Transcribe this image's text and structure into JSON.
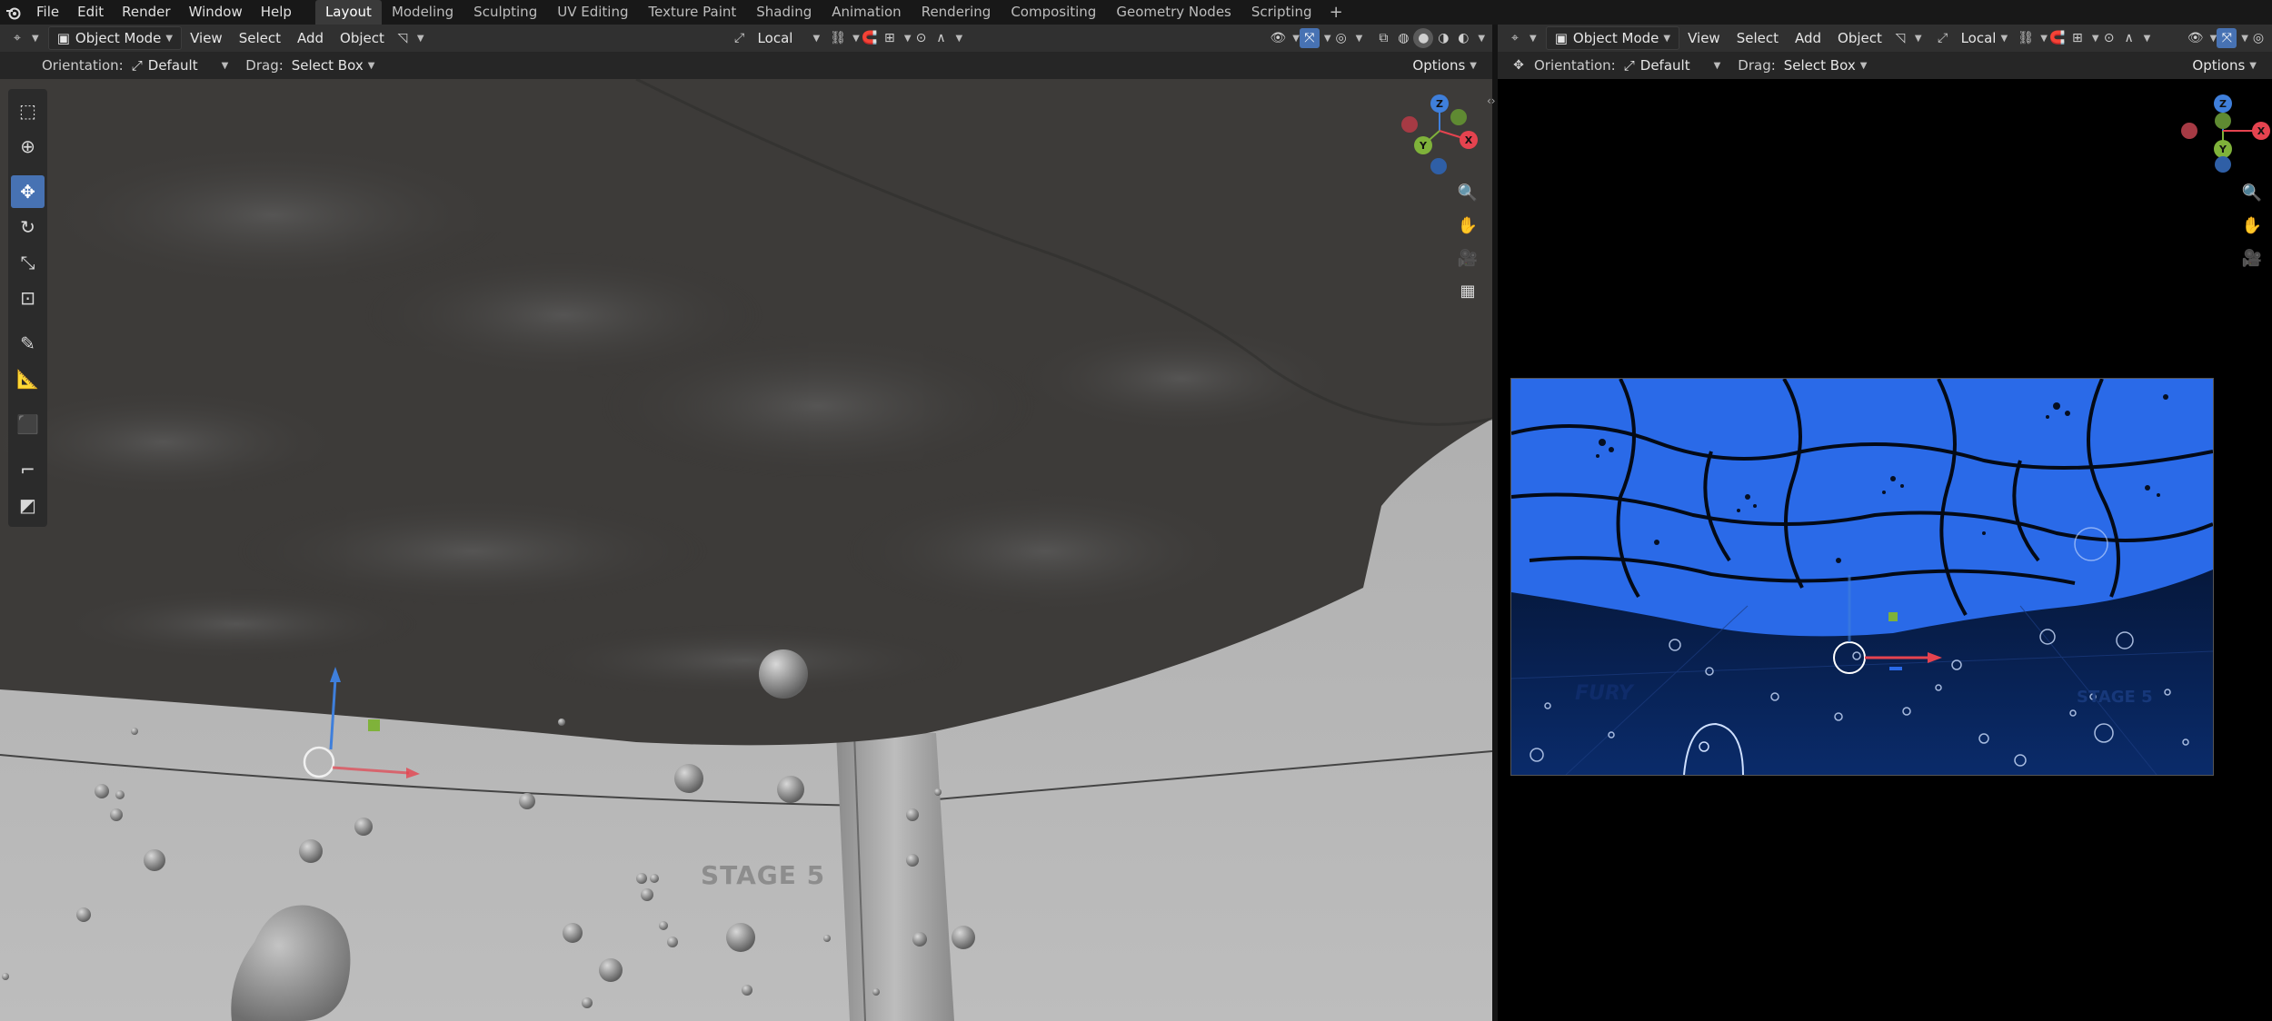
{
  "topbar": {
    "menus": [
      "File",
      "Edit",
      "Render",
      "Window",
      "Help"
    ],
    "workspaces": [
      "Layout",
      "Modeling",
      "Sculpting",
      "UV Editing",
      "Texture Paint",
      "Shading",
      "Animation",
      "Rendering",
      "Compositing",
      "Geometry Nodes",
      "Scripting"
    ],
    "active_workspace": "Layout",
    "add_workspace": "+"
  },
  "left_viewport": {
    "mode": "Object Mode",
    "menus": [
      "View",
      "Select",
      "Add",
      "Object"
    ],
    "transform_orientation": "Local",
    "tool_settings": {
      "orientation_label": "Orientation:",
      "orientation_value": "Default",
      "drag_label": "Drag:",
      "drag_value": "Select Box",
      "options_label": "Options"
    },
    "tools": [
      "select-box",
      "cursor",
      "move",
      "rotate",
      "scale",
      "transform",
      "annotate",
      "measure",
      "add-cube",
      "shear",
      "shrink-fatten"
    ],
    "active_tool": "move",
    "scene_text": {
      "stage_label": "STAGE 5"
    }
  },
  "right_viewport": {
    "mode": "Object Mode",
    "menus": [
      "View",
      "Select",
      "Add",
      "Object"
    ],
    "transform_orientation": "Local",
    "tool_settings": {
      "orientation_label": "Orientation:",
      "orientation_value": "Default",
      "drag_label": "Drag:",
      "drag_value": "Select Box",
      "options_label": "Options"
    },
    "camera_overlay_text": {
      "fury": "FURY",
      "stage": "STAGE 5"
    }
  },
  "gizmo": {
    "axes": [
      "Z",
      "Y",
      "X"
    ],
    "colors": {
      "x": "#e5434f",
      "y": "#7fb23a",
      "z": "#3f7fdb"
    }
  },
  "colors": {
    "accent": "#4772b3",
    "water_blue": "#2a6ae8"
  }
}
